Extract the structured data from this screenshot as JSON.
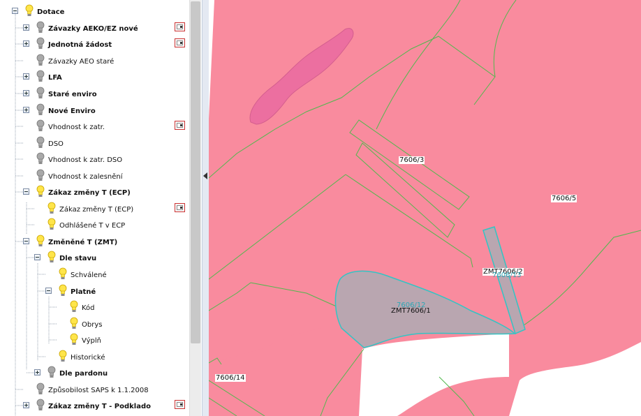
{
  "tree": {
    "items": [
      {
        "label": "Dotace",
        "bold": true,
        "expander": "minus",
        "bulb": "yellow",
        "legend": false
      },
      {
        "label": "Závazky AEKO/EZ nové",
        "bold": true,
        "expander": "plus",
        "bulb": "gray",
        "legend": true
      },
      {
        "label": "Jednotná žádost",
        "bold": true,
        "expander": "plus",
        "bulb": "gray",
        "legend": true
      },
      {
        "label": "Závazky AEO staré",
        "bold": false,
        "expander": null,
        "bulb": "gray",
        "legend": false
      },
      {
        "label": "LFA",
        "bold": true,
        "expander": "plus",
        "bulb": "gray",
        "legend": false
      },
      {
        "label": "Staré enviro",
        "bold": true,
        "expander": "plus",
        "bulb": "gray",
        "legend": false
      },
      {
        "label": "Nové Enviro",
        "bold": true,
        "expander": "plus",
        "bulb": "gray",
        "legend": false
      },
      {
        "label": "Vhodnost k zatr.",
        "bold": false,
        "expander": null,
        "bulb": "gray",
        "legend": true
      },
      {
        "label": "DSO",
        "bold": false,
        "expander": null,
        "bulb": "gray",
        "legend": false
      },
      {
        "label": "Vhodnost k zatr. DSO",
        "bold": false,
        "expander": null,
        "bulb": "gray",
        "legend": false
      },
      {
        "label": "Vhodnost k zalesnění",
        "bold": false,
        "expander": null,
        "bulb": "gray",
        "legend": false
      },
      {
        "label": "Zákaz změny T (ECP)",
        "bold": true,
        "expander": "minus",
        "bulb": "yellow",
        "legend": false
      },
      {
        "label": "Zákaz změny T (ECP)",
        "bold": false,
        "expander": null,
        "bulb": "yellow",
        "legend": true
      },
      {
        "label": "Odhlášené T v ECP",
        "bold": false,
        "expander": null,
        "bulb": "yellow",
        "legend": false
      },
      {
        "label": "Změněné T (ZMT)",
        "bold": true,
        "expander": "minus",
        "bulb": "yellow",
        "legend": false
      },
      {
        "label": "Dle stavu",
        "bold": true,
        "expander": "minus",
        "bulb": "yellow",
        "legend": false
      },
      {
        "label": "Schválené",
        "bold": false,
        "expander": null,
        "bulb": "yellow",
        "legend": false
      },
      {
        "label": "Platné",
        "bold": true,
        "expander": "minus",
        "bulb": "yellow",
        "legend": false
      },
      {
        "label": "Kód",
        "bold": false,
        "expander": null,
        "bulb": "yellow",
        "legend": false
      },
      {
        "label": "Obrys",
        "bold": false,
        "expander": null,
        "bulb": "yellow",
        "legend": false
      },
      {
        "label": "Výplň",
        "bold": false,
        "expander": null,
        "bulb": "yellow",
        "legend": false
      },
      {
        "label": "Historické",
        "bold": false,
        "expander": null,
        "bulb": "yellow",
        "legend": false
      },
      {
        "label": "Dle pardonu",
        "bold": true,
        "expander": "plus",
        "bulb": "gray",
        "legend": false
      },
      {
        "label": "Způsobilost SAPS k 1.1.2008",
        "bold": false,
        "expander": null,
        "bulb": "gray",
        "legend": false
      },
      {
        "label": "Zákaz změny T - Podklado",
        "bold": true,
        "expander": "plus",
        "bulb": "gray",
        "legend": true
      }
    ]
  },
  "map": {
    "parcel_labels": [
      "7606/3",
      "7606/5",
      "ZMT7606/2",
      "7606/12",
      "ZMT7606/1",
      "7606/14",
      "7606/13"
    ],
    "colors": {
      "parcel_fill": "#f98b9e",
      "parcel_border": "#52b84e",
      "zmt_fill": "#b9a6b0",
      "zmt_border": "#33c4c4",
      "water_fill": "#ec6fa0"
    }
  }
}
